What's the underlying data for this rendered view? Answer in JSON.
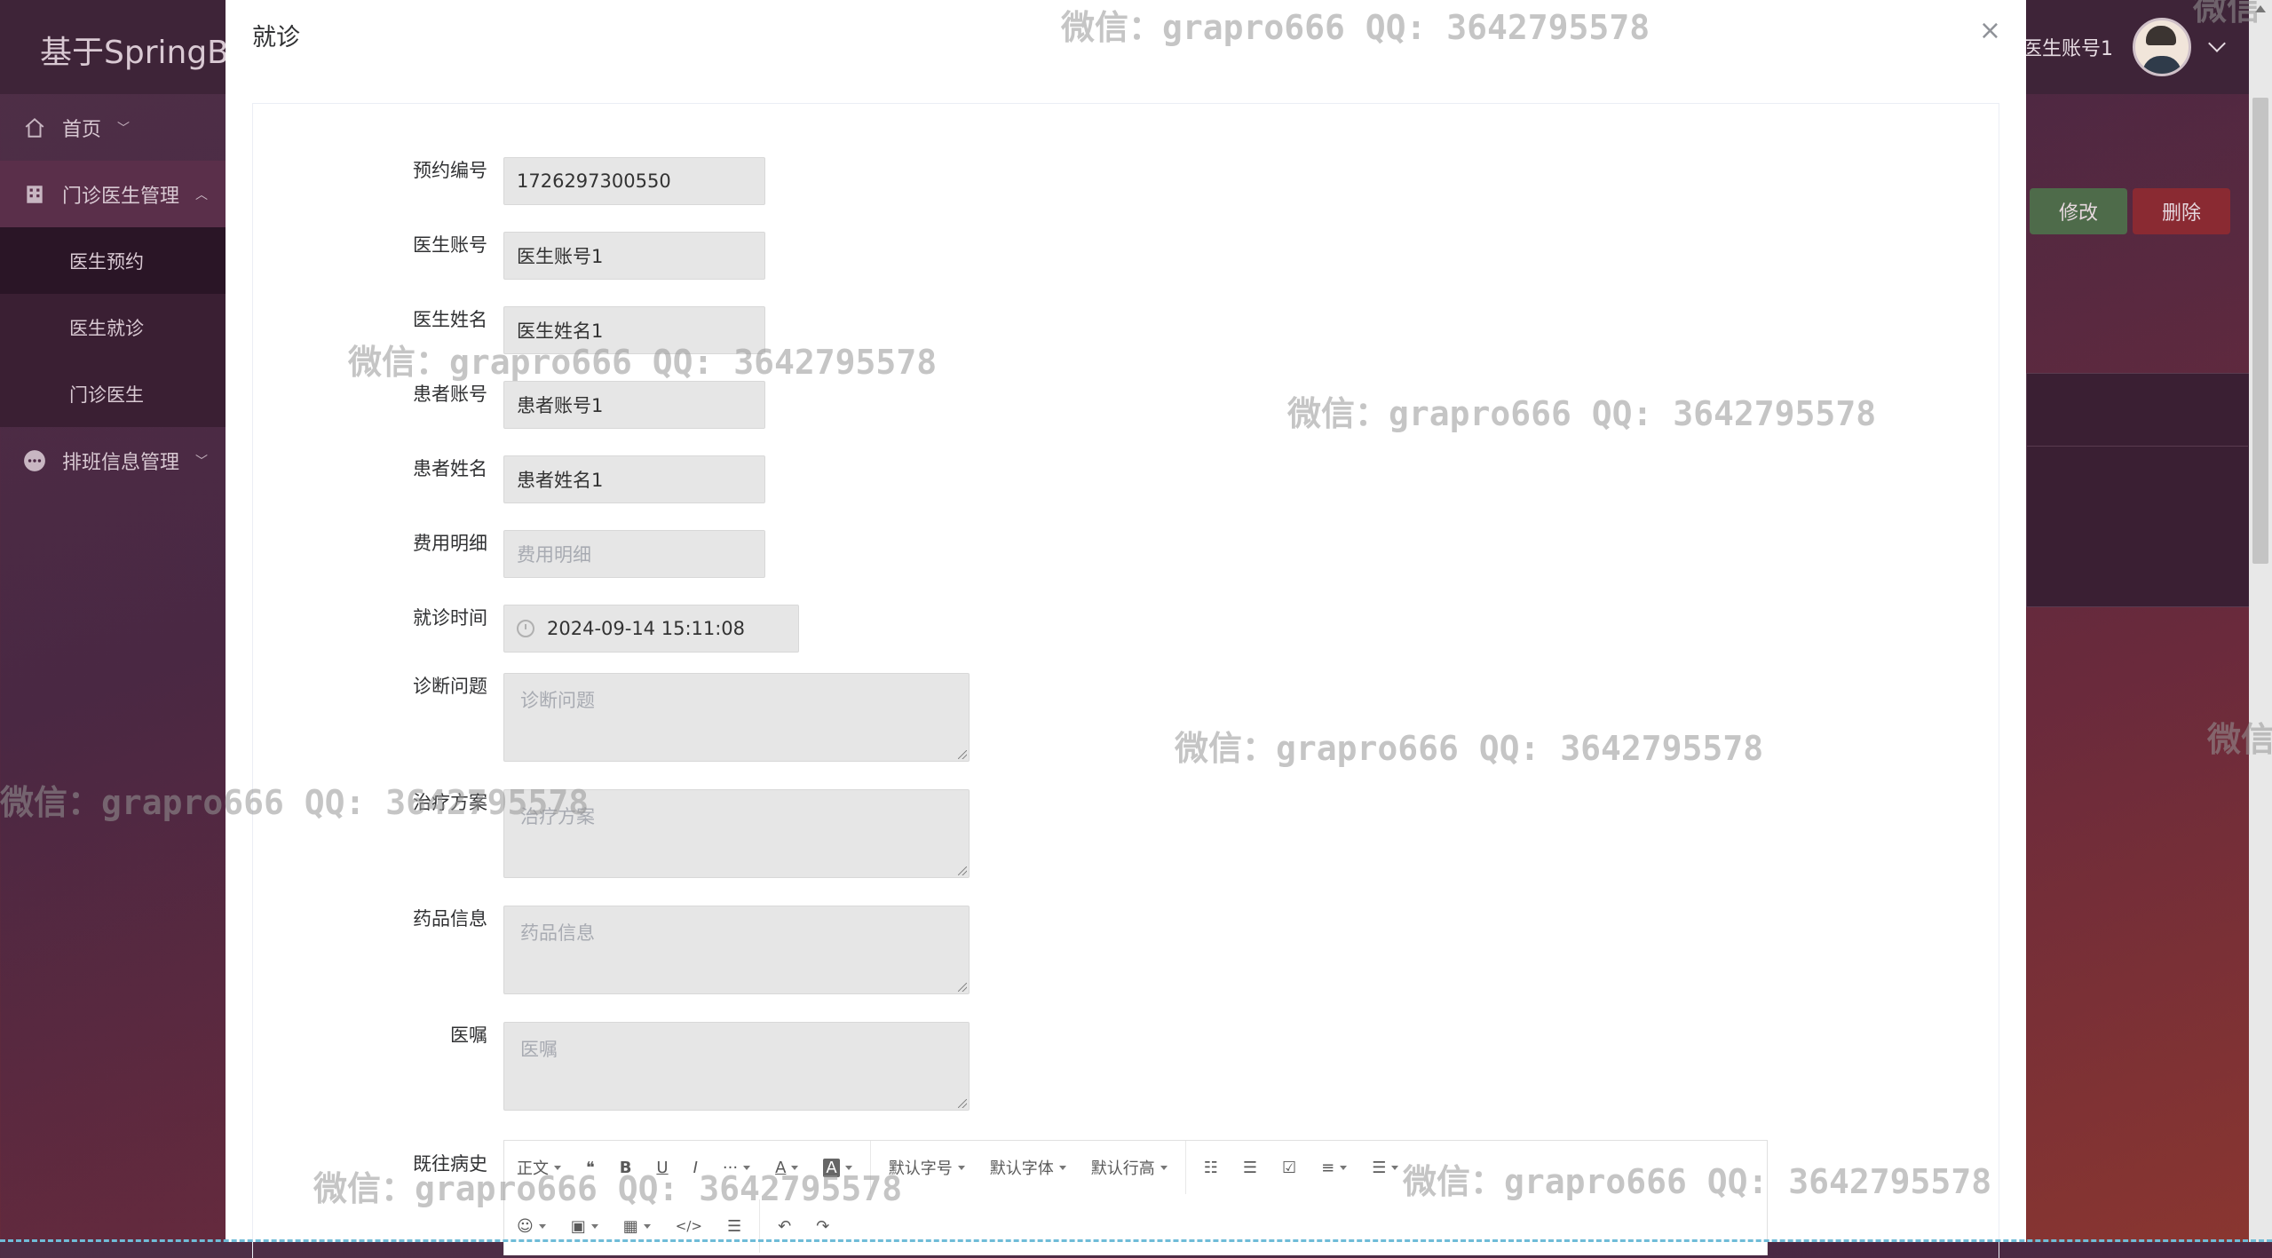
{
  "app": {
    "title": "基于SpringBoot",
    "user_name": "旦 医生账号1"
  },
  "sidebar": {
    "items": [
      {
        "label": "首页"
      },
      {
        "label": "门诊医生管理"
      },
      {
        "label": "排班信息管理"
      }
    ],
    "sub_items": [
      {
        "label": "医生预约"
      },
      {
        "label": "医生就诊"
      },
      {
        "label": "门诊医生"
      }
    ]
  },
  "background_buttons": {
    "edit": "修改",
    "delete": "删除"
  },
  "modal": {
    "title": "就诊",
    "close": "×",
    "fields": {
      "appointment_no": {
        "label": "预约编号",
        "value": "1726297300550"
      },
      "doctor_account": {
        "label": "医生账号",
        "value": "医生账号1"
      },
      "doctor_name": {
        "label": "医生姓名",
        "value": "医生姓名1"
      },
      "patient_account": {
        "label": "患者账号",
        "value": "患者账号1"
      },
      "patient_name": {
        "label": "患者姓名",
        "value": "患者姓名1"
      },
      "fee_detail": {
        "label": "费用明细",
        "placeholder": "费用明细"
      },
      "visit_time": {
        "label": "就诊时间",
        "value": "2024-09-14 15:11:08"
      },
      "diagnosis": {
        "label": "诊断问题",
        "placeholder": "诊断问题"
      },
      "treatment": {
        "label": "治疗方案",
        "placeholder": "治疗方案"
      },
      "medicine": {
        "label": "药品信息",
        "placeholder": "药品信息"
      },
      "advice": {
        "label": "医嘱",
        "placeholder": "医嘱"
      },
      "history": {
        "label": "既往病史"
      }
    },
    "editor_toolbar": {
      "row1": [
        "正文",
        "❝",
        "B",
        "U",
        "I",
        "···",
        "A",
        "A",
        "默认字号",
        "默认字体",
        "默认行高",
        "☷",
        "☰",
        "☑",
        "≡",
        "☰"
      ],
      "row2": [
        "☺",
        "▣",
        "▦",
        "</>",
        "☰",
        "↶",
        "↷"
      ]
    }
  },
  "watermark": "微信：grapro666 QQ: 3642795578",
  "watermark_partial": "微信",
  "colors": {
    "header_bg": "#3e2438",
    "edit_btn": "#4e6b4a",
    "delete_btn": "#8a2a32",
    "input_bg": "#e6e6e6"
  }
}
